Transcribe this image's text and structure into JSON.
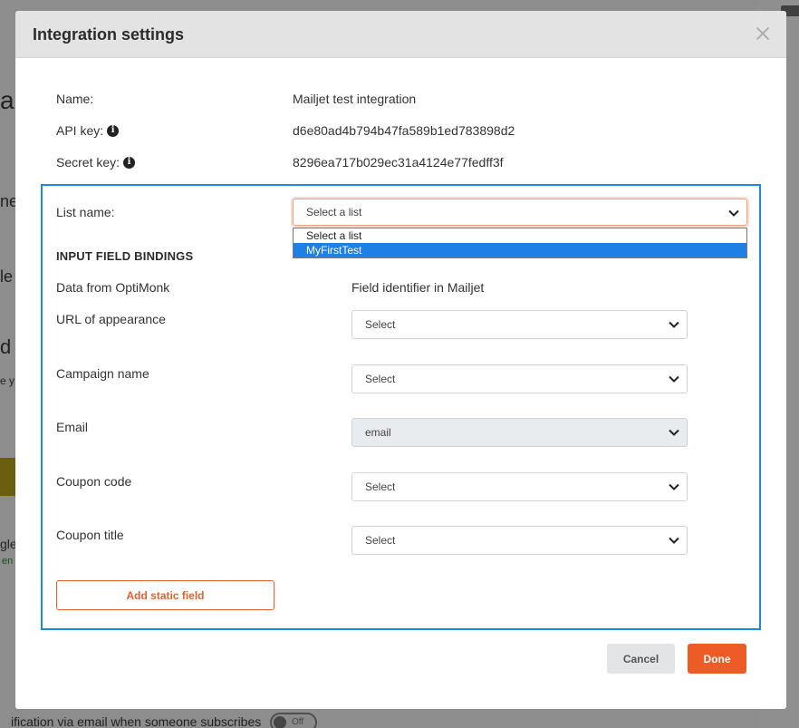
{
  "background": {
    "fragments": [
      "ai",
      "ne",
      "le",
      "d i",
      "e y",
      "gle",
      "en"
    ],
    "bottom_text": "ification via email when someone subscribes",
    "toggle_label": "Off"
  },
  "modal": {
    "title": "Integration settings",
    "close_icon": "close-icon"
  },
  "info": {
    "name_label": "Name:",
    "name_value": "Mailjet test integration",
    "api_key_label": "API key:",
    "api_key_value": "d6e80ad4b794b47fa589b1ed783898d2",
    "secret_key_label": "Secret key:",
    "secret_key_value": "8296ea717b029ec31a4124e77fedff3f"
  },
  "list": {
    "label": "List name:",
    "selected": "Select a list",
    "options": [
      "Select a list",
      "MyFirstTest"
    ],
    "highlighted_option": "MyFirstTest"
  },
  "bindings": {
    "section_title": "INPUT FIELD BINDINGS",
    "col_left": "Data from OptiMonk",
    "col_right": "Field identifier in Mailjet",
    "rows": [
      {
        "label": "URL of appearance",
        "value": "Select",
        "disabled": false
      },
      {
        "label": "Campaign name",
        "value": "Select",
        "disabled": false
      },
      {
        "label": "Email",
        "value": "email",
        "disabled": true
      },
      {
        "label": "Coupon code",
        "value": "Select",
        "disabled": false
      },
      {
        "label": "Coupon title",
        "value": "Select",
        "disabled": false
      }
    ],
    "add_static_label": "Add static field"
  },
  "footer": {
    "cancel_label": "Cancel",
    "done_label": "Done"
  },
  "colors": {
    "accent": "#ed5b27",
    "focus_border": "#1e88e5",
    "selected_option": "#1e7fe5"
  }
}
